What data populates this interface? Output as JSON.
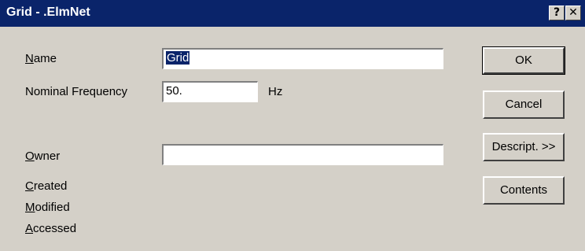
{
  "window": {
    "title": "Grid - .ElmNet",
    "help_glyph": "?",
    "close_glyph": "✕"
  },
  "fields": {
    "name": {
      "label_mnemonic": "N",
      "label_rest": "ame",
      "value": "Grid"
    },
    "nominal_frequency": {
      "label": "Nominal Frequency",
      "value": "50.",
      "unit": "Hz"
    },
    "owner": {
      "label_mnemonic": "O",
      "label_rest": "wner",
      "value": ""
    }
  },
  "info": {
    "created": {
      "label_mnemonic": "C",
      "label_rest": "reated"
    },
    "modified": {
      "label_mnemonic": "M",
      "label_rest": "odified"
    },
    "accessed": {
      "label_mnemonic": "A",
      "label_rest": "ccessed"
    }
  },
  "buttons": {
    "ok": "OK",
    "cancel": "Cancel",
    "descript": "Descript. >>",
    "contents": "Contents"
  }
}
